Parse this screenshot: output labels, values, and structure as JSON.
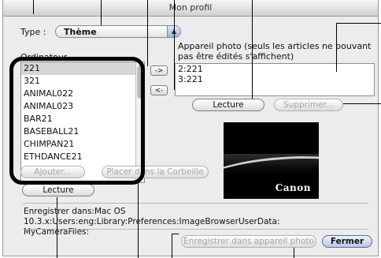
{
  "window": {
    "title": "Mon profil"
  },
  "type": {
    "label": "Type :",
    "value": "Thème"
  },
  "computer": {
    "label": "Ordinateur",
    "items": [
      "221",
      "321",
      "ANIMAL022",
      "ANIMAL023",
      "BAR21",
      "BASEBALL21",
      "CHIMPAN21",
      "ETHDANCE21"
    ],
    "selected_index": 0
  },
  "transfer": {
    "add_label": "->",
    "remove_label": "<-"
  },
  "camera": {
    "label": "Appareil photo (seuls les articles ne pouvant pas être édités s'affichent)",
    "items": [
      "2:221",
      "3:221"
    ]
  },
  "buttons": {
    "ajouter": "Ajouter...",
    "placer": "Placer dans la Corbeille",
    "lecture_left": "Lecture",
    "lecture_right": "Lecture",
    "supprimer": "Supprimer...",
    "enregistrer_appareil": "Enregistrer dans appareil photo",
    "fermer": "Fermer"
  },
  "preview": {
    "logo_text": "Canon"
  },
  "save_path": {
    "line1": "Enregistrer dans:Mac OS 10.3.x:Users:eng:Library:Preferences:ImageBrowserUserData:",
    "line2": "MyCameraFiles:"
  }
}
